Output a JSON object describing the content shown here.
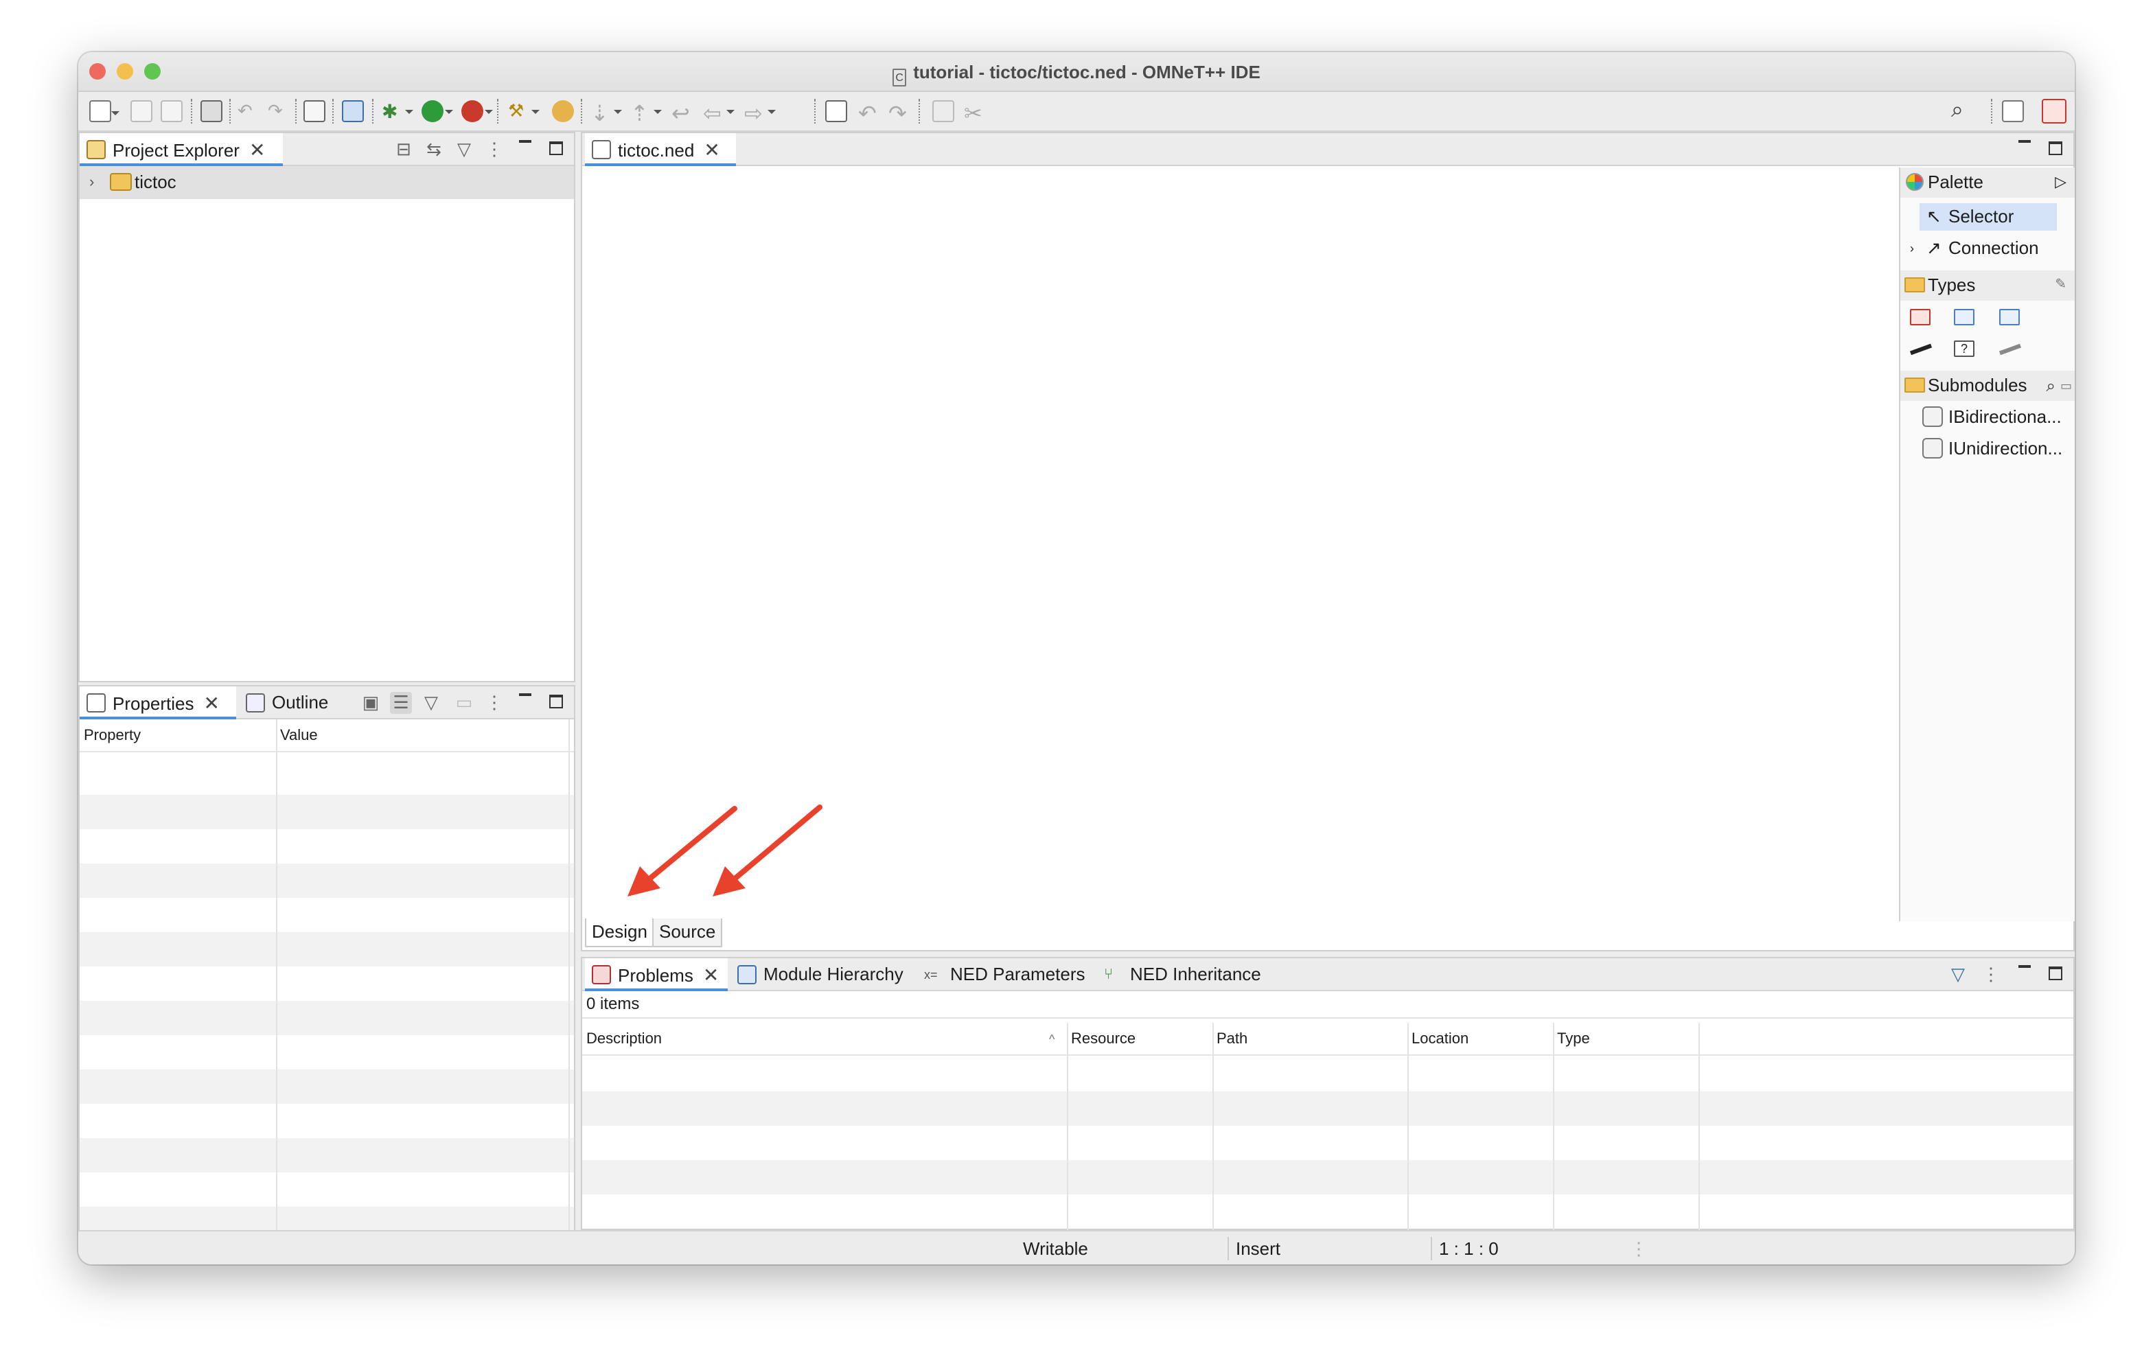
{
  "window": {
    "title": "tutorial - tictoc/tictoc.ned - OMNeT++ IDE",
    "title_icon_glyph": "C",
    "traffic_lights": [
      "#ed6a5e",
      "#f5bf4f",
      "#61c554"
    ]
  },
  "project_explorer": {
    "tab_label": "Project Explorer",
    "tree": [
      {
        "label": "tictoc",
        "icon": "project-folder-icon"
      }
    ]
  },
  "properties_view": {
    "tabs": [
      "Properties",
      "Outline"
    ],
    "columns": [
      "Property",
      "Value"
    ]
  },
  "editor": {
    "tab_label": "tictoc.ned",
    "bottom_tabs": [
      "Design",
      "Source"
    ],
    "palette": {
      "header": "Palette",
      "tools": [
        "Selector",
        "Connection"
      ],
      "types_label": "Types",
      "submodules_label": "Submodules",
      "submodules": [
        "IBidirectiona...",
        "IUnidirection..."
      ]
    }
  },
  "problems_view": {
    "tabs": [
      "Problems",
      "Module Hierarchy",
      "NED Parameters",
      "NED Inheritance"
    ],
    "count_label": "0 items",
    "columns": [
      "Description",
      "Resource",
      "Path",
      "Location",
      "Type"
    ]
  },
  "status_bar": {
    "mode": "Writable",
    "insert": "Insert",
    "position": "1 : 1 : 0"
  },
  "colors": {
    "accent": "#4a90d9",
    "annotation_arrow": "#e8412c"
  }
}
